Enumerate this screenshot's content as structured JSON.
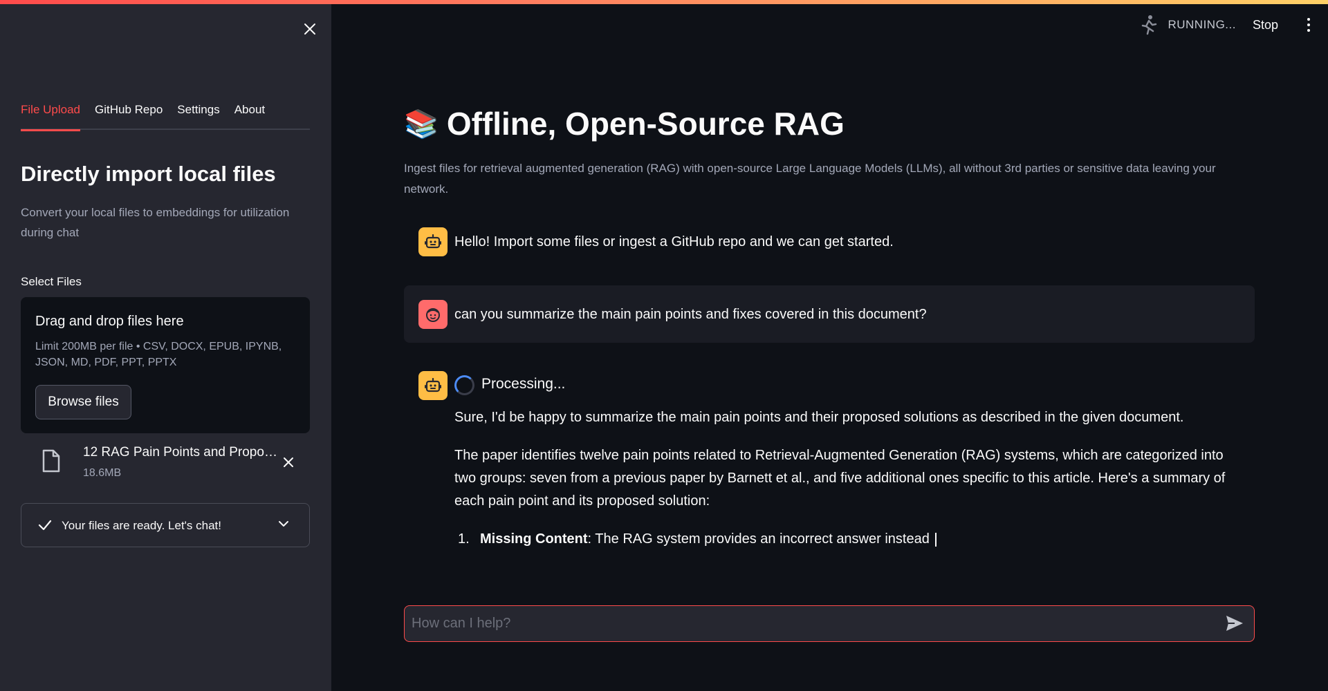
{
  "sidebar": {
    "tabs": [
      {
        "label": "File Upload"
      },
      {
        "label": "GitHub Repo"
      },
      {
        "label": "Settings"
      },
      {
        "label": "About"
      }
    ],
    "title": "Directly import local files",
    "description": "Convert your local files to embeddings for utilization during chat",
    "select_label": "Select Files",
    "dropzone": {
      "title": "Drag and drop files here",
      "limit": "Limit 200MB per file • CSV, DOCX, EPUB, IPYNB, JSON, MD, PDF, PPT, PPTX",
      "browse_label": "Browse files"
    },
    "file": {
      "name": "12 RAG Pain Points and Proposed Solutions.pdf",
      "size": "18.6MB"
    },
    "status": "Your files are ready. Let's chat!"
  },
  "header": {
    "running_text": "RUNNING...",
    "stop_label": "Stop"
  },
  "main": {
    "title_emoji": "📚",
    "title": "Offline, Open-Source RAG",
    "description": "Ingest files for retrieval augmented generation (RAG) with open-source Large Language Models (LLMs), all without 3rd parties or sensitive data leaving your network."
  },
  "chat": {
    "greeting": "Hello! Import some files or ingest a GitHub repo and we can get started.",
    "user_message": "can you summarize the main pain points and fixes covered in this document?",
    "processing": "Processing...",
    "answer_p1": "Sure, I'd be happy to summarize the main pain points and their proposed solutions as described in the given document.",
    "answer_p2": "The paper identifies twelve pain points related to Retrieval-Augmented Generation (RAG) systems, which are categorized into two groups: seven from a previous paper by Barnett et al., and five additional ones specific to this article. Here's a summary of each pain point and its proposed solution:",
    "list_item": {
      "number": "1.",
      "bold": "Missing Content",
      "text": ": The RAG system provides an incorrect answer instead"
    }
  },
  "input": {
    "placeholder": "How can I help?"
  },
  "colors": {
    "accent": "#ff4b4b",
    "bot_avatar": "#ffbd45",
    "user_avatar": "#ff6b6b"
  }
}
